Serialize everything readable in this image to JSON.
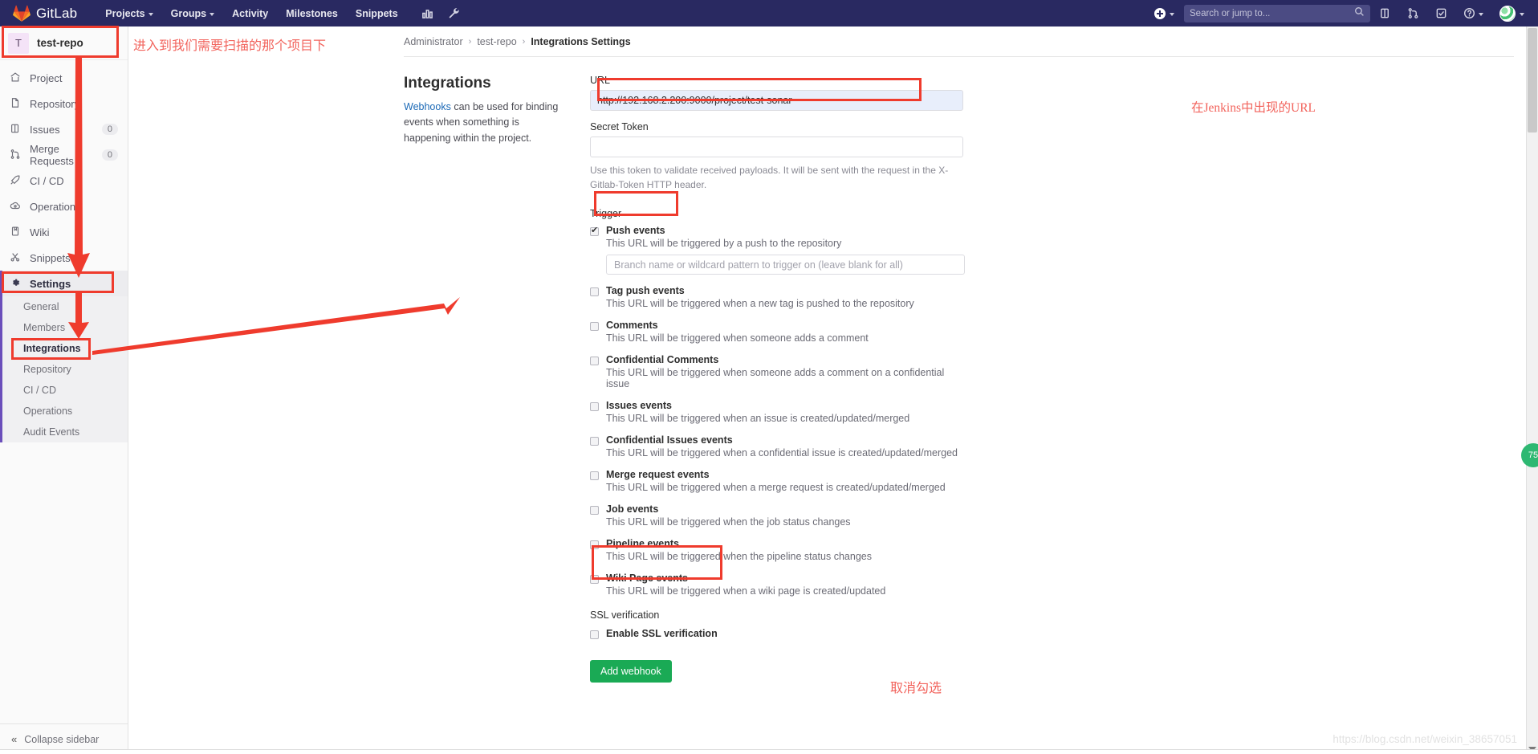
{
  "navbar": {
    "brand": "GitLab",
    "logo_icon": "gitlab-fox-icon",
    "links": [
      {
        "label": "Projects",
        "has_caret": true
      },
      {
        "label": "Groups",
        "has_caret": true
      },
      {
        "label": "Activity",
        "has_caret": false
      },
      {
        "label": "Milestones",
        "has_caret": false
      },
      {
        "label": "Snippets",
        "has_caret": false
      }
    ],
    "icons": [
      "chart-bar-icon",
      "wrench-icon"
    ],
    "create_new_icon": "plus-circle-icon",
    "search_placeholder": "Search or jump to...",
    "search_value": "",
    "search_icon": "search-icon",
    "right_icons": [
      "issues-icon",
      "merge-requests-icon",
      "todos-icon"
    ],
    "help_icon": "question-circle-icon",
    "avatar_icon": "user-avatar"
  },
  "sidebar": {
    "project_initial": "T",
    "project_name": "test-repo",
    "items": [
      {
        "label": "Project",
        "icon": "home-icon",
        "badge": ""
      },
      {
        "label": "Repository",
        "icon": "file-icon",
        "badge": ""
      },
      {
        "label": "Issues",
        "icon": "issues-icon",
        "badge": "0"
      },
      {
        "label": "Merge Requests",
        "icon": "merge-icon",
        "badge": "0"
      },
      {
        "label": "CI / CD",
        "icon": "rocket-icon",
        "badge": ""
      },
      {
        "label": "Operations",
        "icon": "cloud-gear-icon",
        "badge": ""
      },
      {
        "label": "Wiki",
        "icon": "book-icon",
        "badge": ""
      },
      {
        "label": "Snippets",
        "icon": "scissors-icon",
        "badge": ""
      }
    ],
    "settings": {
      "label": "Settings",
      "icon": "gear-icon"
    },
    "sub_items": [
      {
        "label": "General",
        "active": false
      },
      {
        "label": "Members",
        "active": false
      },
      {
        "label": "Integrations",
        "active": true
      },
      {
        "label": "Repository",
        "active": false
      },
      {
        "label": "CI / CD",
        "active": false
      },
      {
        "label": "Operations",
        "active": false
      },
      {
        "label": "Audit Events",
        "active": false
      }
    ],
    "collapse_label": "Collapse sidebar",
    "collapse_icon": "chevron-double-left-icon"
  },
  "breadcrumb": {
    "items": [
      "Administrator",
      "test-repo",
      "Integrations Settings"
    ]
  },
  "page": {
    "title": "Integrations",
    "description_link": "Webhooks",
    "description_rest": " can be used for binding events when something is happening within the project."
  },
  "form": {
    "url_label": "URL",
    "url_value": "http://192.168.2.200:9000/project/test-sonar",
    "secret_label": "Secret Token",
    "secret_value": "",
    "secret_help": "Use this token to validate received payloads. It will be sent with the request in the X-Gitlab-Token HTTP header.",
    "trigger_label": "Trigger",
    "branch_placeholder": "Branch name or wildcard pattern to trigger on (leave blank for all)",
    "branch_value": "",
    "events": [
      {
        "label": "Push events",
        "desc": "This URL will be triggered by a push to the repository",
        "checked": true,
        "has_branch_input": true
      },
      {
        "label": "Tag push events",
        "desc": "This URL will be triggered when a new tag is pushed to the repository",
        "checked": false,
        "has_branch_input": false
      },
      {
        "label": "Comments",
        "desc": "This URL will be triggered when someone adds a comment",
        "checked": false,
        "has_branch_input": false
      },
      {
        "label": "Confidential Comments",
        "desc": "This URL will be triggered when someone adds a comment on a confidential issue",
        "checked": false,
        "has_branch_input": false
      },
      {
        "label": "Issues events",
        "desc": "This URL will be triggered when an issue is created/updated/merged",
        "checked": false,
        "has_branch_input": false
      },
      {
        "label": "Confidential Issues events",
        "desc": "This URL will be triggered when a confidential issue is created/updated/merged",
        "checked": false,
        "has_branch_input": false
      },
      {
        "label": "Merge request events",
        "desc": "This URL will be triggered when a merge request is created/updated/merged",
        "checked": false,
        "has_branch_input": false
      },
      {
        "label": "Job events",
        "desc": "This URL will be triggered when the job status changes",
        "checked": false,
        "has_branch_input": false
      },
      {
        "label": "Pipeline events",
        "desc": "This URL will be triggered when the pipeline status changes",
        "checked": false,
        "has_branch_input": false
      },
      {
        "label": "Wiki Page events",
        "desc": "This URL will be triggered when a wiki page is created/updated",
        "checked": false,
        "has_branch_input": false
      }
    ],
    "ssl_title": "SSL verification",
    "ssl_label": "Enable SSL verification",
    "ssl_checked": false,
    "submit_label": "Add webhook"
  },
  "annotations": {
    "top_left": "进入到我们需要扫描的那个项目下",
    "url_note": "在Jenkins中出现的URL",
    "ssl_note": "取消勾选"
  },
  "watermark": "https://blog.csdn.net/weixin_38657051",
  "colors": {
    "navbar": "#292961",
    "accent_purple": "#6b4fbb",
    "green_button": "#1aaa55",
    "annotation_red": "#ef3b2d",
    "link_blue": "#1b69b6"
  },
  "float_badge": "75"
}
